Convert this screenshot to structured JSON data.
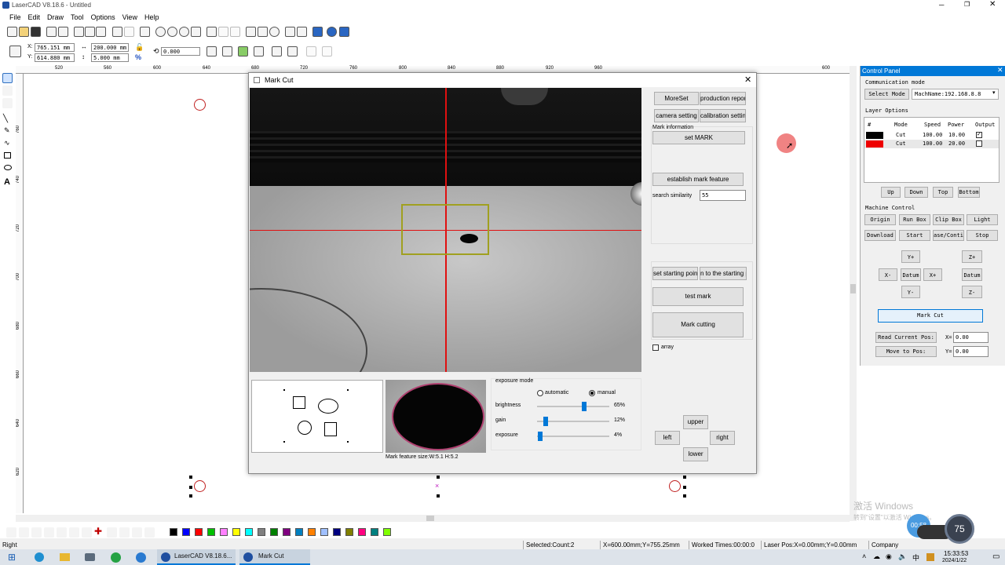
{
  "window": {
    "title": "LaserCAD V8.18.6 - Untitled"
  },
  "menu": [
    "File",
    "Edit",
    "Draw",
    "Tool",
    "Options",
    "View",
    "Help"
  ],
  "propbar": {
    "x": "765.151 mm",
    "y": "614.880 mm",
    "w": "200.000 mm",
    "h": "5.000 mm",
    "percent": "%",
    "rotate": "0.000"
  },
  "ruler": {
    "top": [
      "520",
      "560",
      "600",
      "640",
      "680",
      "720",
      "760",
      "800",
      "840",
      "880",
      "920",
      "960",
      "600"
    ],
    "left": [
      "760",
      "740",
      "720",
      "700",
      "680",
      "660",
      "640",
      "620"
    ]
  },
  "dialog": {
    "title": "Mark Cut",
    "buttons": {
      "moreset": "MoreSet",
      "production_report": "production report",
      "camera_setting": "camera setting",
      "calibration_setting": "calibration setting",
      "set_mark": "set MARK",
      "establish": "establish mark feature",
      "set_start": "set starting point",
      "return_start": "n to the starting p",
      "test_mark": "test mark",
      "mark_cutting": "Mark cutting",
      "upper": "upper",
      "left": "left",
      "right": "right",
      "lower": "lower"
    },
    "mark_information": "Mark information",
    "search_similarity_label": "search similarity",
    "search_similarity_value": "55",
    "array_label": "array",
    "exposure": {
      "title": "exposure mode",
      "automatic": "automatic",
      "manual": "manual",
      "selected": "manual",
      "rows": [
        {
          "label": "brightness",
          "value": "65%",
          "level": 0.65
        },
        {
          "label": "gain",
          "value": "12%",
          "level": 0.12
        },
        {
          "label": "exposure",
          "value": "4%",
          "level": 0.04
        }
      ]
    },
    "feature_size": "Mark feature size:W:5.1  H:5.2"
  },
  "control_panel": {
    "title": "Control Panel",
    "comm_mode": "Communication mode",
    "select_mode": "Select Mode",
    "machine_name": "MachName:192.168.8.8",
    "layer_options": "Layer Options",
    "layer_headers": [
      "#",
      "Mode",
      "Speed",
      "Power",
      "Output"
    ],
    "layers": [
      {
        "color": "#000000",
        "mode": "Cut",
        "speed": "100.00",
        "power": "10.00",
        "output": true
      },
      {
        "color": "#ee0000",
        "mode": "Cut",
        "speed": "100.00",
        "power": "20.00",
        "output": false
      }
    ],
    "layer_buttons": [
      "Up",
      "Down",
      "Top",
      "Bottom"
    ],
    "machine_control": "Machine Control",
    "mc_row1": [
      "Origin",
      "Run Box",
      "Clip Box",
      "Light"
    ],
    "mc_row2": [
      "Download",
      "Start",
      "ase/Contin",
      "Stop"
    ],
    "jog": {
      "yp": "Y+",
      "ym": "Y-",
      "xm": "X-",
      "xp": "X+",
      "datum": "Datum",
      "zp": "Z+",
      "zm": "Z-",
      "zdatum": "Datum"
    },
    "mark_cut": "Mark Cut",
    "read_pos": "Read Current Pos:",
    "move_pos": "Move to Pos:",
    "x_label": "X=",
    "x_value": "0.00",
    "y_label": "Y=",
    "y_value": "0.00"
  },
  "palette": [
    "#000000",
    "#0000ff",
    "#ff0000",
    "#00c000",
    "#ff80ff",
    "#ffff00",
    "#00ffff",
    "#808080",
    "#008000",
    "#800080",
    "#0080c0",
    "#ff8000",
    "#a0c0ff",
    "#000080",
    "#808000",
    "#ff0080",
    "#008080",
    "#80ff00"
  ],
  "status": {
    "left": "Right",
    "selected": "Selected:Count:2",
    "coords": "X=600.00mm;Y=755.25mm",
    "worked": "Worked Times:00:00:0",
    "laser_pos": "Laser Pos:X=0.00mm;Y=0.00mm",
    "company": "Company"
  },
  "watermark": {
    "line1": "激活 Windows",
    "line2": "转到\"设置\"以激活 Windows。"
  },
  "overlay": {
    "timer": "00:58",
    "percent": "75"
  },
  "taskbar": {
    "app1": "LaserCAD V8.18.6...",
    "app2": "Mark Cut",
    "time": "15:33:53",
    "date": "2024/1/22",
    "ime": "中"
  },
  "colors": {
    "accent": "#0078d7",
    "cross": "#e01010",
    "rect": "#a0a020"
  }
}
